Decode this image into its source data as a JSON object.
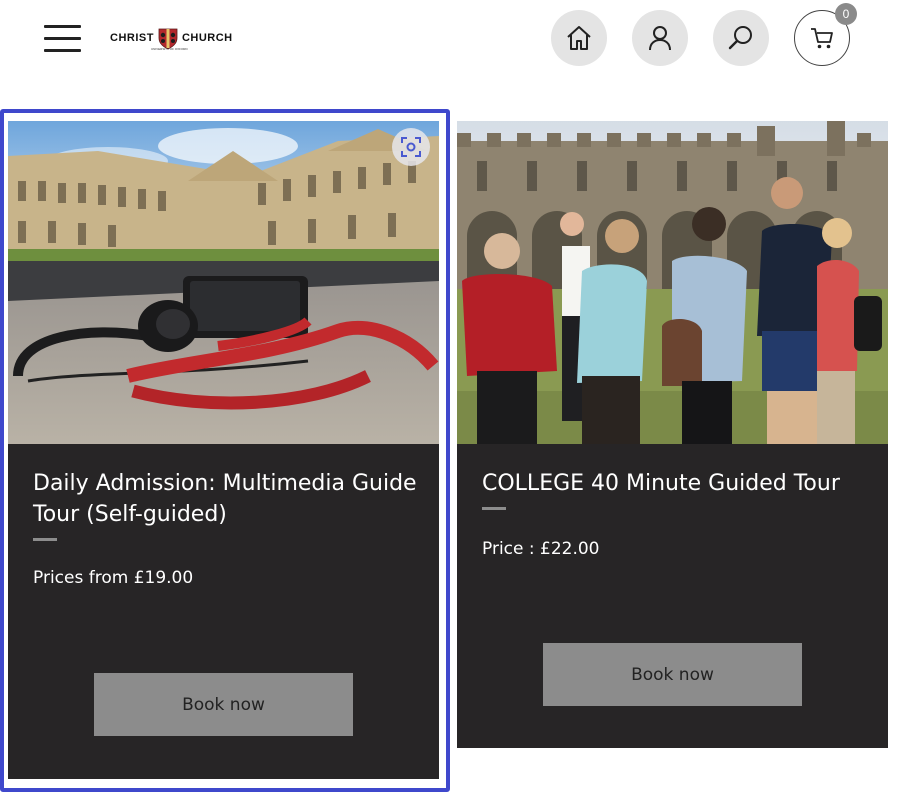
{
  "header": {
    "logo_left": "CHRIST",
    "logo_right": "CHURCH",
    "logo_sub": "UNIVERSITY OF OXFORD",
    "cart_count": "0",
    "icons": [
      "menu-icon",
      "home-icon",
      "user-icon",
      "search-icon",
      "cart-icon"
    ]
  },
  "products": [
    {
      "title": "Daily Admission: Multimedia Guide Tour (Self-guided)",
      "price": "Prices from £19.00",
      "button": "Book now",
      "image": "audio guide headphones with red lanyard in college quad"
    },
    {
      "title": "COLLEGE 40 Minute Guided Tour",
      "price": "Price : £22.00",
      "button": "Book now",
      "image": "guide with tour group in college quadrangle"
    }
  ],
  "colors": {
    "card_bg": "#272526",
    "button_bg": "#8c8c8c",
    "focus_outline": "#3f48cc",
    "icon_circle": "#e4e4e4"
  }
}
